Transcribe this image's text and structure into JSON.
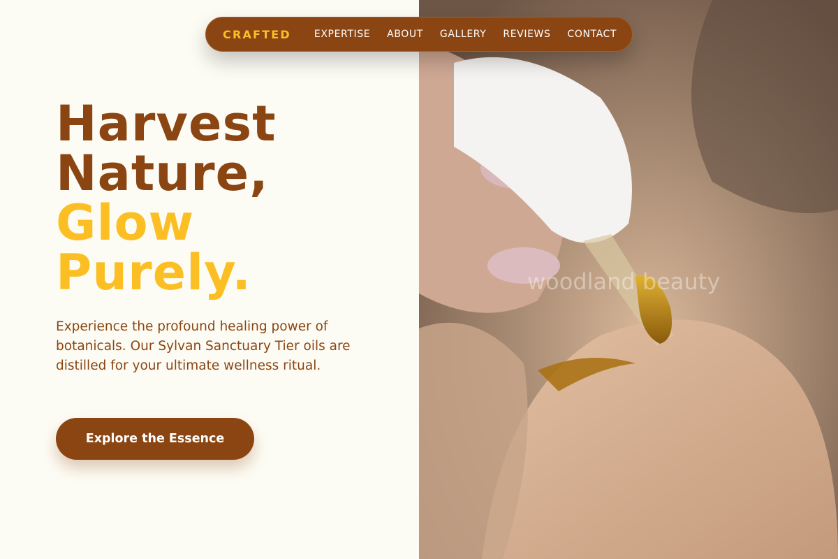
{
  "nav": {
    "brand": "CRAFTED",
    "items": [
      "EXPERTISE",
      "ABOUT",
      "GALLERY",
      "REVIEWS",
      "CONTACT"
    ]
  },
  "hero": {
    "headline_line1": "Harvest",
    "headline_line2": "Nature,",
    "headline_line3": "Glow",
    "headline_line4": "Purely.",
    "description": "Experience the profound healing power of botanicals. Our Sylvan Sanctuary Tier oils are distilled for your ultimate wellness ritual.",
    "cta_label": "Explore the Essence"
  },
  "image": {
    "watermark": "woodland beauty",
    "subject": "dropper-oil-on-hand-photo"
  },
  "colors": {
    "brand_brown": "#8b4513",
    "accent_gold": "#fbbf24",
    "background": "#fdfcf4"
  }
}
